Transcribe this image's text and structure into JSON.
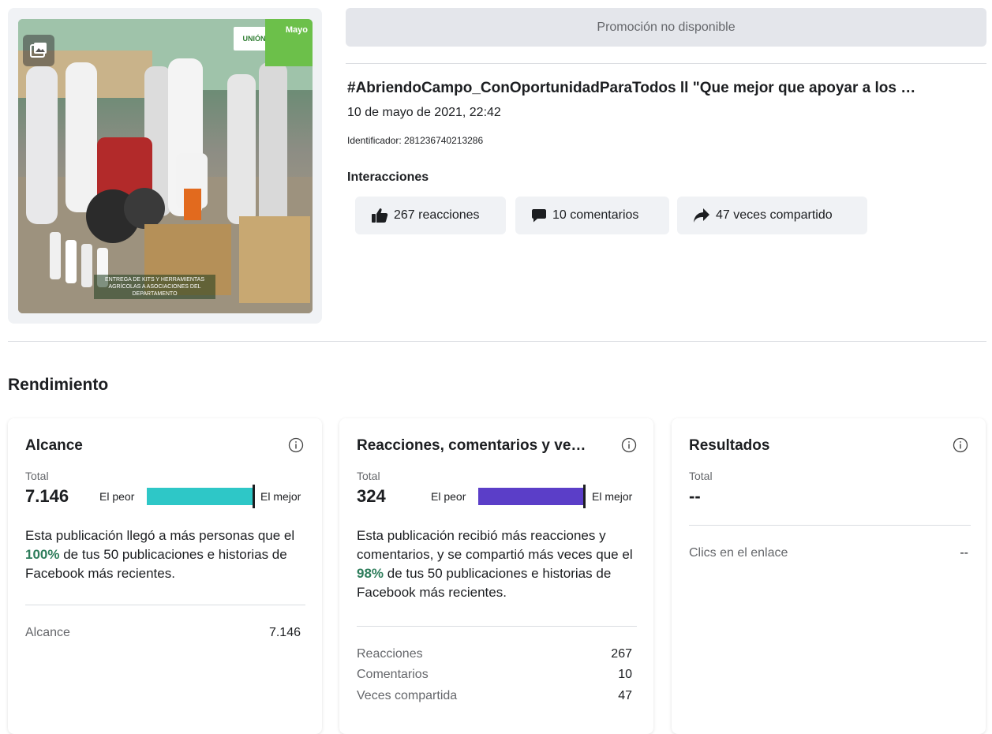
{
  "post": {
    "image_logo_text": "UNIÓN",
    "image_month_tag": "Mayo",
    "image_caption": "ENTREGA DE KITS Y HERRAMIENTAS AGRÍCOLAS A ASOCIACIONES DEL DEPARTAMENTO",
    "promo_label": "Promoción no disponible",
    "title": "#AbriendoCampo_ConOportunidadParaTodos ll \"Que mejor que apoyar a los …",
    "date": "10 de mayo de 2021, 22:42",
    "identifier": "Identificador: 281236740213286",
    "interactions_label": "Interacciones",
    "interactions": {
      "reactions": "267 reacciones",
      "comments": "10 comentarios",
      "shares": "47 veces compartido"
    }
  },
  "performance": {
    "section_title": "Rendimiento",
    "reach": {
      "title": "Alcance",
      "total_label": "Total",
      "total_value": "7.146",
      "worst_label": "El peor",
      "best_label": "El mejor",
      "bar_fill": 1.0,
      "bar_color": "#2ec7c7",
      "desc_pre": "Esta publicación llegó a más personas que el ",
      "desc_pct": "100%",
      "desc_post": " de tus 50 publicaciones e historias de Facebook más recientes.",
      "rows": [
        {
          "label": "Alcance",
          "value": "7.146"
        }
      ]
    },
    "engagement": {
      "title": "Reacciones, comentarios y ve…",
      "total_label": "Total",
      "total_value": "324",
      "worst_label": "El peor",
      "best_label": "El mejor",
      "bar_fill": 0.98,
      "bar_color": "#5b3ec8",
      "desc_pre": "Esta publicación recibió más reacciones y comentarios, y se compartió más veces que el ",
      "desc_pct": "98%",
      "desc_post": " de tus 50 publicaciones e historias de Facebook más recientes.",
      "rows": [
        {
          "label": "Reacciones",
          "value": "267"
        },
        {
          "label": "Comentarios",
          "value": "10"
        },
        {
          "label": "Veces compartida",
          "value": "47"
        }
      ]
    },
    "results": {
      "title": "Resultados",
      "total_label": "Total",
      "total_value": "--",
      "rows": [
        {
          "label": "Clics en el enlace",
          "value": "--"
        }
      ]
    }
  },
  "colors": {
    "accent_green": "#2e7d5b",
    "pill_bg": "#f0f2f5"
  }
}
